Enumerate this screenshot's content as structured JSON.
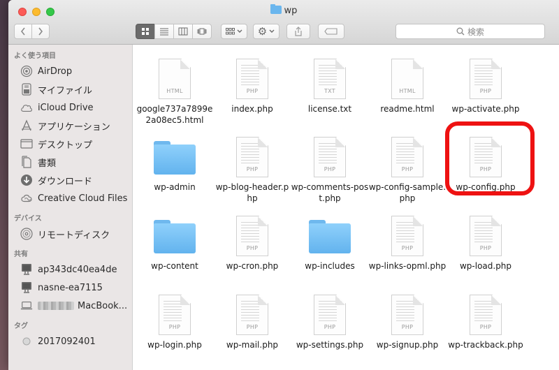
{
  "window": {
    "title": "wp"
  },
  "toolbar": {
    "search_placeholder": "検索"
  },
  "sidebar": {
    "sections": [
      {
        "header": "よく使う項目",
        "items": [
          {
            "label": "AirDrop",
            "icon": "airdrop-icon"
          },
          {
            "label": "マイファイル",
            "icon": "my-files-icon"
          },
          {
            "label": "iCloud Drive",
            "icon": "cloud-icon"
          },
          {
            "label": "アプリケーション",
            "icon": "applications-icon"
          },
          {
            "label": "デスクトップ",
            "icon": "desktop-icon"
          },
          {
            "label": "書類",
            "icon": "documents-icon"
          },
          {
            "label": "ダウンロード",
            "icon": "download-icon"
          },
          {
            "label": "Creative Cloud Files",
            "icon": "creative-cloud-icon"
          }
        ]
      },
      {
        "header": "デバイス",
        "items": [
          {
            "label": "リモートディスク",
            "icon": "disc-icon"
          }
        ]
      },
      {
        "header": "共有",
        "items": [
          {
            "label": "ap343dc40ea4de",
            "icon": "computer-icon"
          },
          {
            "label": "nasne-ea7115",
            "icon": "computer-icon"
          },
          {
            "label": "MacBook...",
            "icon": "laptop-icon"
          }
        ]
      },
      {
        "header": "タグ",
        "items": [
          {
            "label": "2017092401",
            "icon": "tag-dot-icon"
          }
        ]
      }
    ]
  },
  "files": [
    {
      "name": "google737a7899e2a08ec5.html",
      "kind": "doc",
      "ext": "HTML"
    },
    {
      "name": "index.php",
      "kind": "doc",
      "ext": "PHP"
    },
    {
      "name": "license.txt",
      "kind": "doc",
      "ext": "TXT"
    },
    {
      "name": "readme.html",
      "kind": "doc",
      "ext": "HTML"
    },
    {
      "name": "wp-activate.php",
      "kind": "doc",
      "ext": "PHP"
    },
    {
      "name": "wp-admin",
      "kind": "folder",
      "ext": ""
    },
    {
      "name": "wp-blog-header.php",
      "kind": "doc",
      "ext": "PHP"
    },
    {
      "name": "wp-comments-post.php",
      "kind": "doc",
      "ext": "PHP"
    },
    {
      "name": "wp-config-sample.php",
      "kind": "doc",
      "ext": "PHP"
    },
    {
      "name": "wp-config.php",
      "kind": "doc",
      "ext": "PHP"
    },
    {
      "name": "wp-content",
      "kind": "folder",
      "ext": ""
    },
    {
      "name": "wp-cron.php",
      "kind": "doc",
      "ext": "PHP"
    },
    {
      "name": "wp-includes",
      "kind": "folder",
      "ext": ""
    },
    {
      "name": "wp-links-opml.php",
      "kind": "doc",
      "ext": "PHP"
    },
    {
      "name": "wp-load.php",
      "kind": "doc",
      "ext": "PHP"
    },
    {
      "name": "wp-login.php",
      "kind": "doc",
      "ext": "PHP"
    },
    {
      "name": "wp-mail.php",
      "kind": "doc",
      "ext": "PHP"
    },
    {
      "name": "wp-settings.php",
      "kind": "doc",
      "ext": "PHP"
    },
    {
      "name": "wp-signup.php",
      "kind": "doc",
      "ext": "PHP"
    },
    {
      "name": "wp-trackback.php",
      "kind": "doc",
      "ext": "PHP"
    }
  ],
  "colors": {
    "highlight": "#ee1212",
    "folder": "#6fb8ee",
    "active_view": "#6b6b6b"
  }
}
